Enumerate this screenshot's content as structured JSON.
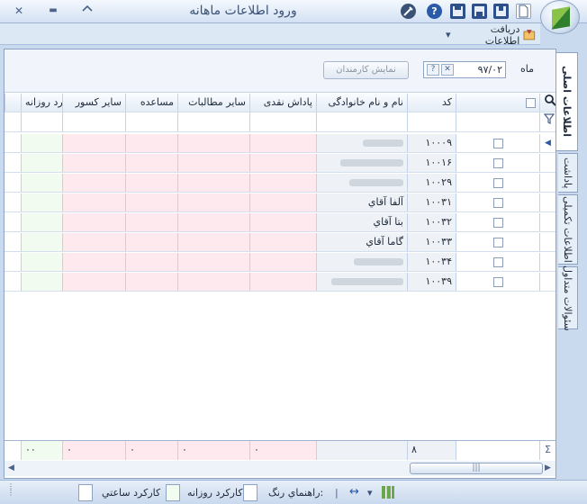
{
  "window": {
    "title": "ورود اطلاعات ماهانه",
    "close_glyph": "✕",
    "minimize_glyph": "▬"
  },
  "toolbar": {
    "icons": [
      "new-doc-icon",
      "save-icon",
      "save-as-icon",
      "export-icon",
      "help-icon",
      "settings-icon"
    ],
    "help_glyph": "?"
  },
  "ribbon": {
    "get_data_label": "دریافت اطلاعات",
    "dropdown_glyph": "▾"
  },
  "tabs": [
    {
      "label": "اطلاعات اصلی",
      "active": true
    },
    {
      "label": "پاداشت",
      "active": false
    },
    {
      "label": "اطلاعات تکمیلی",
      "active": false
    },
    {
      "label": "سئوالات متداول",
      "active": false
    }
  ],
  "filter": {
    "month_label": "ماه",
    "month_value": "۹۷/۰۲",
    "clear_glyph": "✕",
    "picker_glyph": "?",
    "show_button": "نمایش کارمندان"
  },
  "grid": {
    "columns": [
      "کد",
      "نام و نام خانوادگی",
      "پاداش نقدی",
      "سایر مطالبات",
      "مساعده",
      "سایر کسور",
      "کارکرد روزانه"
    ],
    "rows": [
      {
        "code": "۱۰۰۰۹",
        "name": ""
      },
      {
        "code": "۱۰۰۱۶",
        "name": ""
      },
      {
        "code": "۱۰۰۲۹",
        "name": ""
      },
      {
        "code": "۱۰۰۳۱",
        "name": "آلفا آقاي"
      },
      {
        "code": "۱۰۰۳۲",
        "name": "بتا آقاي"
      },
      {
        "code": "۱۰۰۳۳",
        "name": "گاما آقاي"
      },
      {
        "code": "۱۰۰۳۴",
        "name": ""
      },
      {
        "code": "۱۰۰۳۹",
        "name": ""
      }
    ],
    "summary": {
      "count": "۸",
      "reward": "۰",
      "other_claims": "۰",
      "advance": "۰",
      "other_deductions": "۰",
      "daily_work": "۰۰",
      "sigma": "Σ"
    },
    "scroll_grip": "|||"
  },
  "statusbar": {
    "guide_label": "راهنماي رنگ:",
    "daily_label": "کارکرد روزانه",
    "hourly_label": "کارکرد ساعتي",
    "arrows_glyph": "↔",
    "dropdown_glyph": "▾"
  },
  "colors": {
    "pink_cell": "#fde9ee",
    "green_cell": "#f1fbef",
    "frame_blue": "#c9d9ee"
  }
}
